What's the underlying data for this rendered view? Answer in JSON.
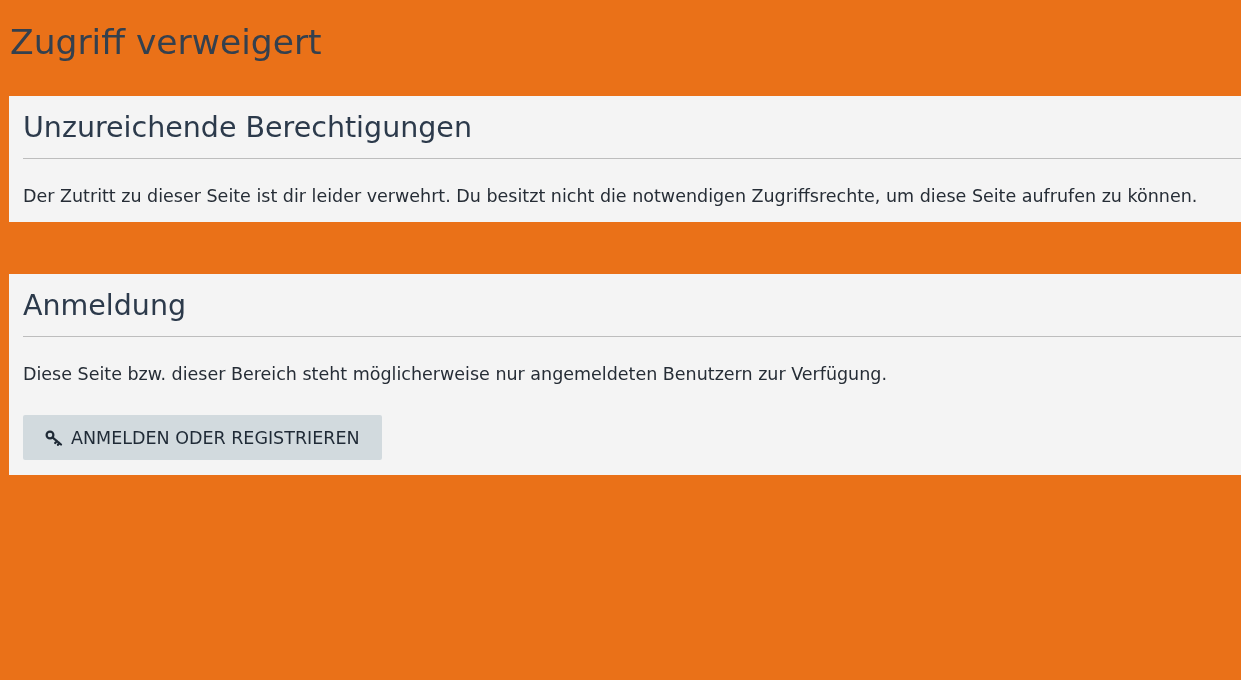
{
  "page_title": "Zugriff verweigert",
  "panels": [
    {
      "heading": "Unzureichende Berechtigungen",
      "text": "Der Zutritt zu dieser Seite ist dir leider verwehrt. Du besitzt nicht die notwendigen Zugriffsrechte, um diese Seite aufrufen zu können."
    },
    {
      "heading": "Anmeldung",
      "text": "Diese Seite bzw. dieser Bereich steht möglicherweise nur angemeldeten Benutzern zur Verfügung.",
      "button": {
        "label": "ANMELDEN ODER REGISTRIEREN"
      }
    }
  ]
}
